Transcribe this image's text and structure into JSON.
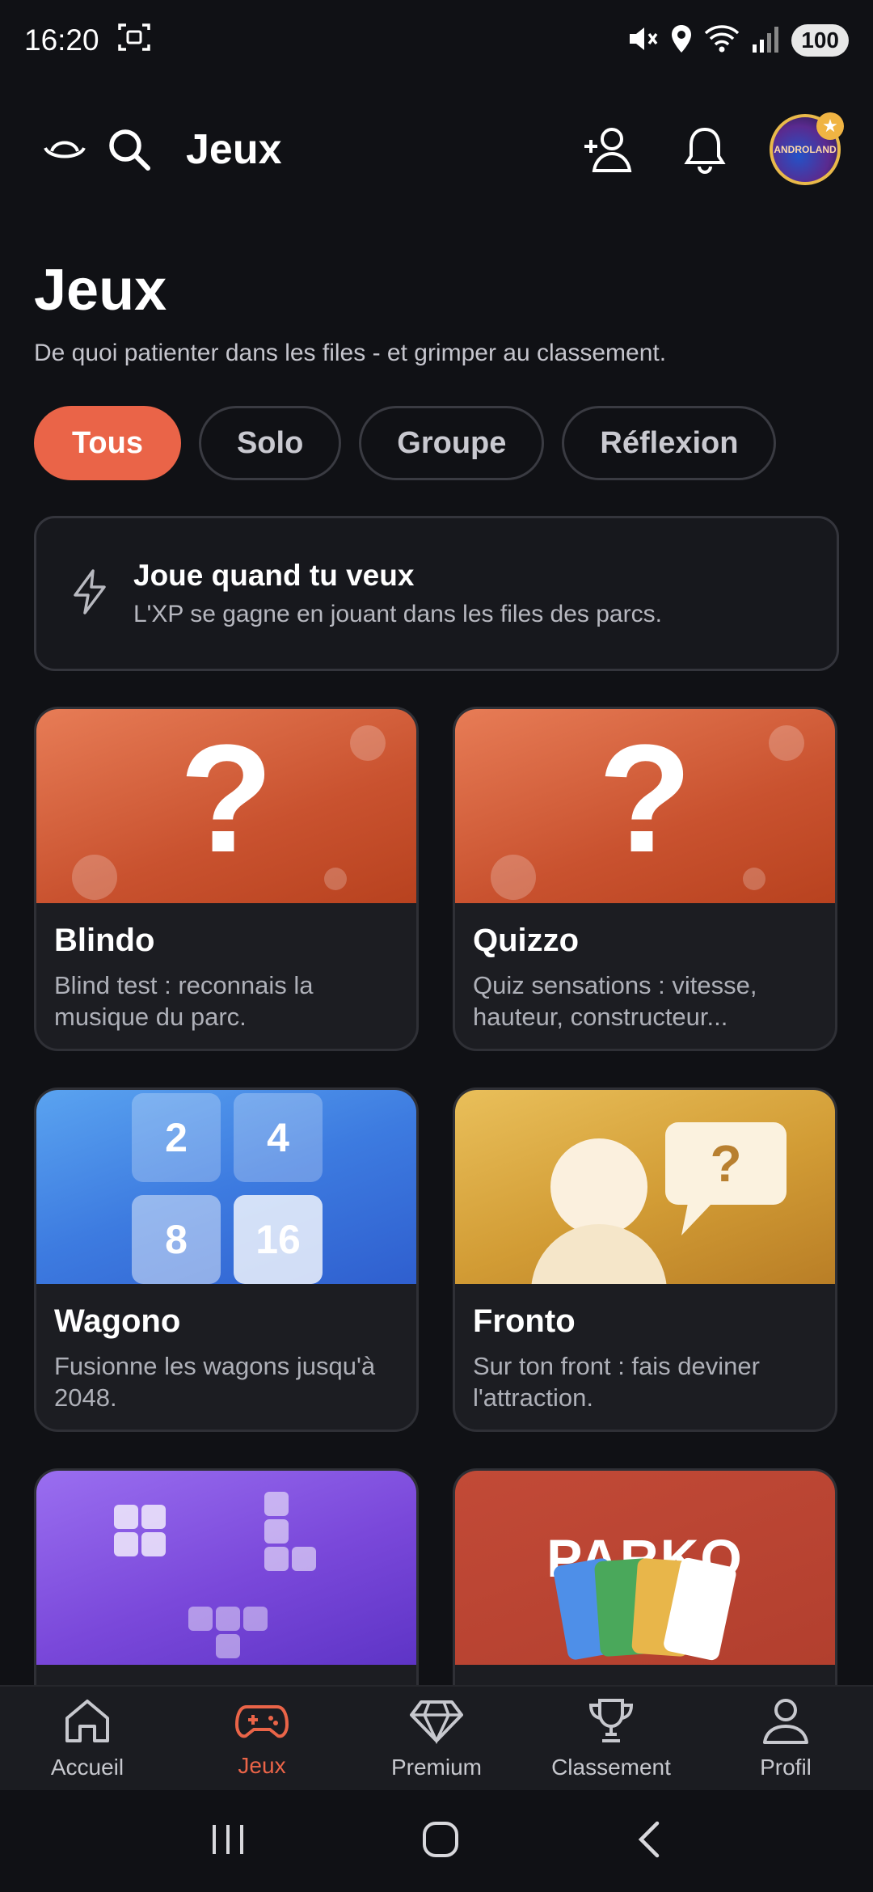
{
  "status": {
    "time": "16:20",
    "battery": "100"
  },
  "header": {
    "title": "Jeux",
    "avatar_text": "ANDROLAND",
    "avatar_badge": "★"
  },
  "page": {
    "title": "Jeux",
    "subtitle": "De quoi patienter dans les files - et grimper au classement."
  },
  "filters": [
    "Tous",
    "Solo",
    "Groupe",
    "Réflexion"
  ],
  "banner": {
    "title": "Joue quand tu veux",
    "subtitle": "L'XP se gagne en jouant dans les files des parcs."
  },
  "games": [
    {
      "title": "Blindo",
      "desc": "Blind test : reconnais la musique du parc."
    },
    {
      "title": "Quizzo",
      "desc": "Quiz sensations : vitesse, hauteur, constructeur..."
    },
    {
      "title": "Wagono",
      "desc": "Fusionne les wagons jusqu'à 2048."
    },
    {
      "title": "Fronto",
      "desc": "Sur ton front : fais deviner l'attraction."
    }
  ],
  "tiles": {
    "a": "2",
    "b": "4",
    "c": "8",
    "d": "16"
  },
  "glyphs": {
    "question": "?"
  },
  "parko_label": "PARKO",
  "nav": {
    "items": [
      "Accueil",
      "Jeux",
      "Premium",
      "Classement",
      "Profil"
    ],
    "active": "Jeux"
  },
  "colors": {
    "accent": "#ea6448",
    "background": "#101115",
    "card": "#1c1d22"
  }
}
